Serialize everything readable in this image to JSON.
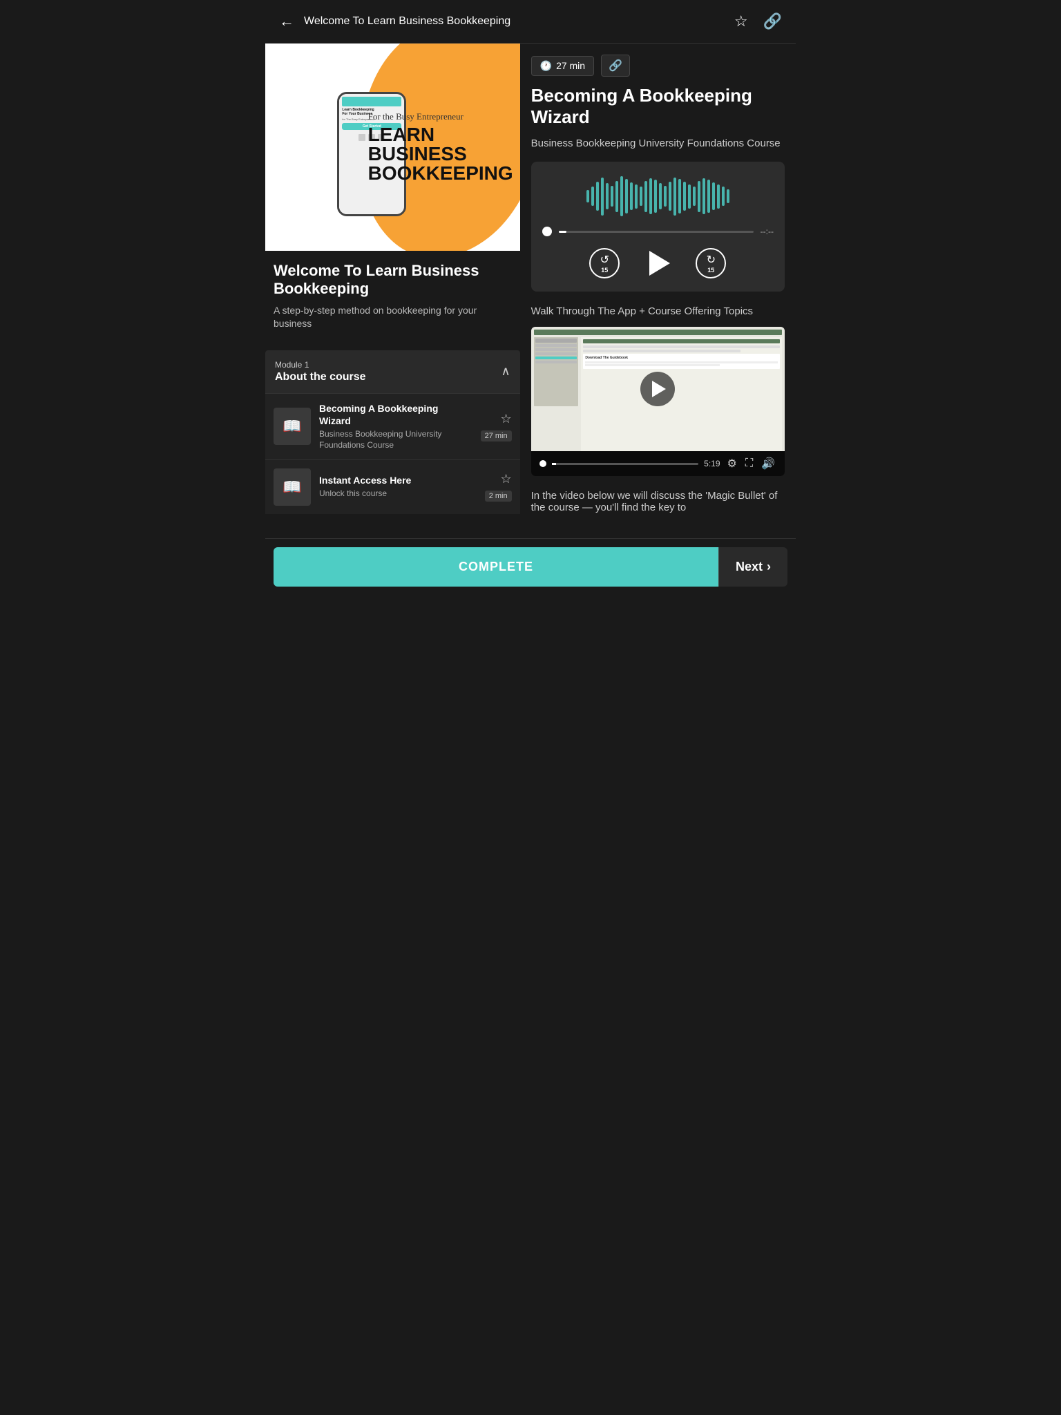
{
  "header": {
    "title": "Welcome To Learn Business Bookkeeping",
    "back_label": "←",
    "bookmark_icon": "☆",
    "link_icon": "🔗"
  },
  "course_image": {
    "script_text": "For the Busy Entrepreneur",
    "bold_text": "LEARN BUSINESS BOOKKEEPING"
  },
  "course_info": {
    "title": "Welcome To Learn Business Bookkeeping",
    "subtitle": "A step-by-step method on bookkeeping for your business"
  },
  "module": {
    "label": "Module 1",
    "name": "About the course"
  },
  "course_items": [
    {
      "title": "Becoming A Bookkeeping Wizard",
      "subtitle": "Business Bookkeeping University Foundations Course",
      "duration": "27 min"
    },
    {
      "title": "Instant Access Here",
      "subtitle": "Unlock this course",
      "duration": "2 min"
    }
  ],
  "content": {
    "duration": "27 min",
    "title": "Becoming A Bookkeeping Wizard",
    "source": "Business Bookkeeping University Foundations Course",
    "description": "Walk Through The App + Course Offering Topics",
    "time_elapsed": "--:--",
    "video_time": "5:19",
    "magic_text": "In the video below we will discuss the 'Magic Bullet' of the course — you'll find the key to"
  },
  "controls": {
    "rewind_label": "15",
    "forward_label": "15"
  },
  "bottom_bar": {
    "complete_label": "COMPLETE",
    "next_label": "Next"
  },
  "waveform_bars": [
    18,
    28,
    42,
    55,
    38,
    30,
    45,
    58,
    50,
    40,
    35,
    28,
    45,
    52,
    48,
    38,
    30,
    42,
    55,
    50,
    42,
    35,
    28,
    45,
    52,
    48,
    40,
    35,
    28,
    20
  ]
}
